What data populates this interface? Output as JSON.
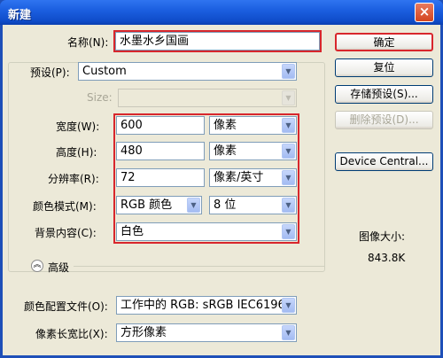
{
  "window": {
    "title": "新建",
    "close_glyph": "×"
  },
  "form": {
    "name_label": "名称(N):",
    "name_value": "水墨水乡国画",
    "preset_label": "预设(P):",
    "preset_value": "Custom",
    "size_label": "Size:",
    "size_value": "",
    "width_label": "宽度(W):",
    "width_value": "600",
    "width_unit": "像素",
    "height_label": "高度(H):",
    "height_value": "480",
    "height_unit": "像素",
    "resolution_label": "分辨率(R):",
    "resolution_value": "72",
    "resolution_unit": "像素/英寸",
    "color_mode_label": "颜色模式(M):",
    "color_mode_value": "RGB 颜色",
    "bit_depth_value": "8 位",
    "background_label": "背景内容(C):",
    "background_value": "白色",
    "advanced_label": "高级",
    "advanced_toggle_glyph": "︽",
    "color_profile_label": "颜色配置文件(O):",
    "color_profile_value": "工作中的 RGB: sRGB IEC6196...",
    "pixel_aspect_label": "像素长宽比(X):",
    "pixel_aspect_value": "方形像素"
  },
  "buttons": {
    "ok": "确定",
    "reset": "复位",
    "save_preset": "存储预设(S)...",
    "delete_preset": "删除预设(D)...",
    "device_central": "Device Central..."
  },
  "info": {
    "image_size_label": "图像大小:",
    "image_size_value": "843.8K"
  },
  "dropdown_arrow": "▼",
  "colors": {
    "highlight_border": "#d8262c",
    "titlebar": "#1b5fe0",
    "dialog_bg": "#ece9d8"
  }
}
